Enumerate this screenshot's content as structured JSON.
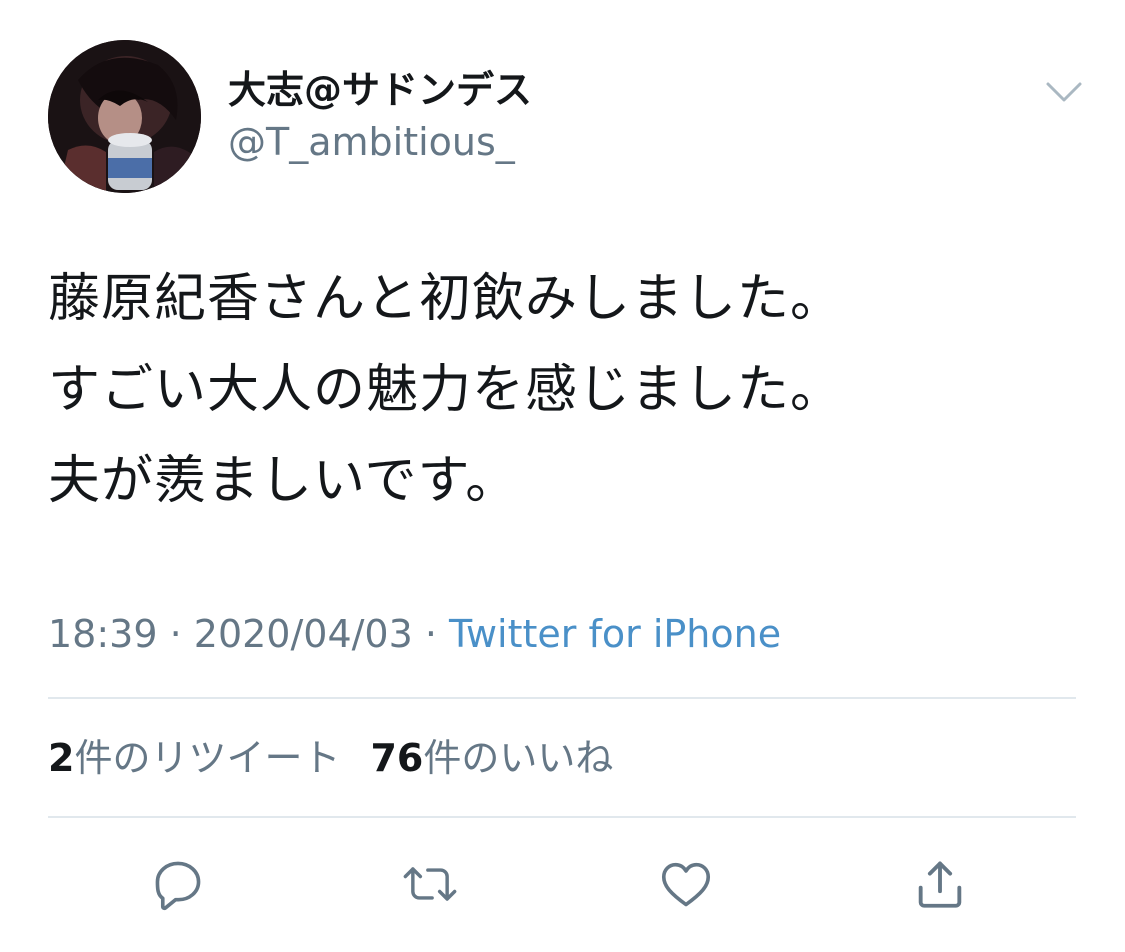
{
  "author": {
    "display_name": "大志@サドンデス",
    "handle": "@T_ambitious_"
  },
  "tweet": {
    "lines": [
      "藤原紀香さんと初飲みしました。",
      "すごい大人の魅力を感じました。",
      "夫が羨ましいです。"
    ]
  },
  "meta": {
    "time": "18:39",
    "separator": " · ",
    "date": "2020/04/03",
    "source": "Twitter for iPhone"
  },
  "stats": {
    "retweets_count": "2",
    "retweets_label": "件のリツイート",
    "likes_count": "76",
    "likes_label": "件のいいね"
  },
  "icons": {
    "more": "chevron-down-icon",
    "reply": "reply-icon",
    "retweet": "retweet-icon",
    "like": "heart-icon",
    "share": "share-icon"
  },
  "colors": {
    "text": "#14171a",
    "secondary": "#657786",
    "link": "#4a90c8",
    "divider": "#e1e8ed",
    "icon": "#657786"
  }
}
